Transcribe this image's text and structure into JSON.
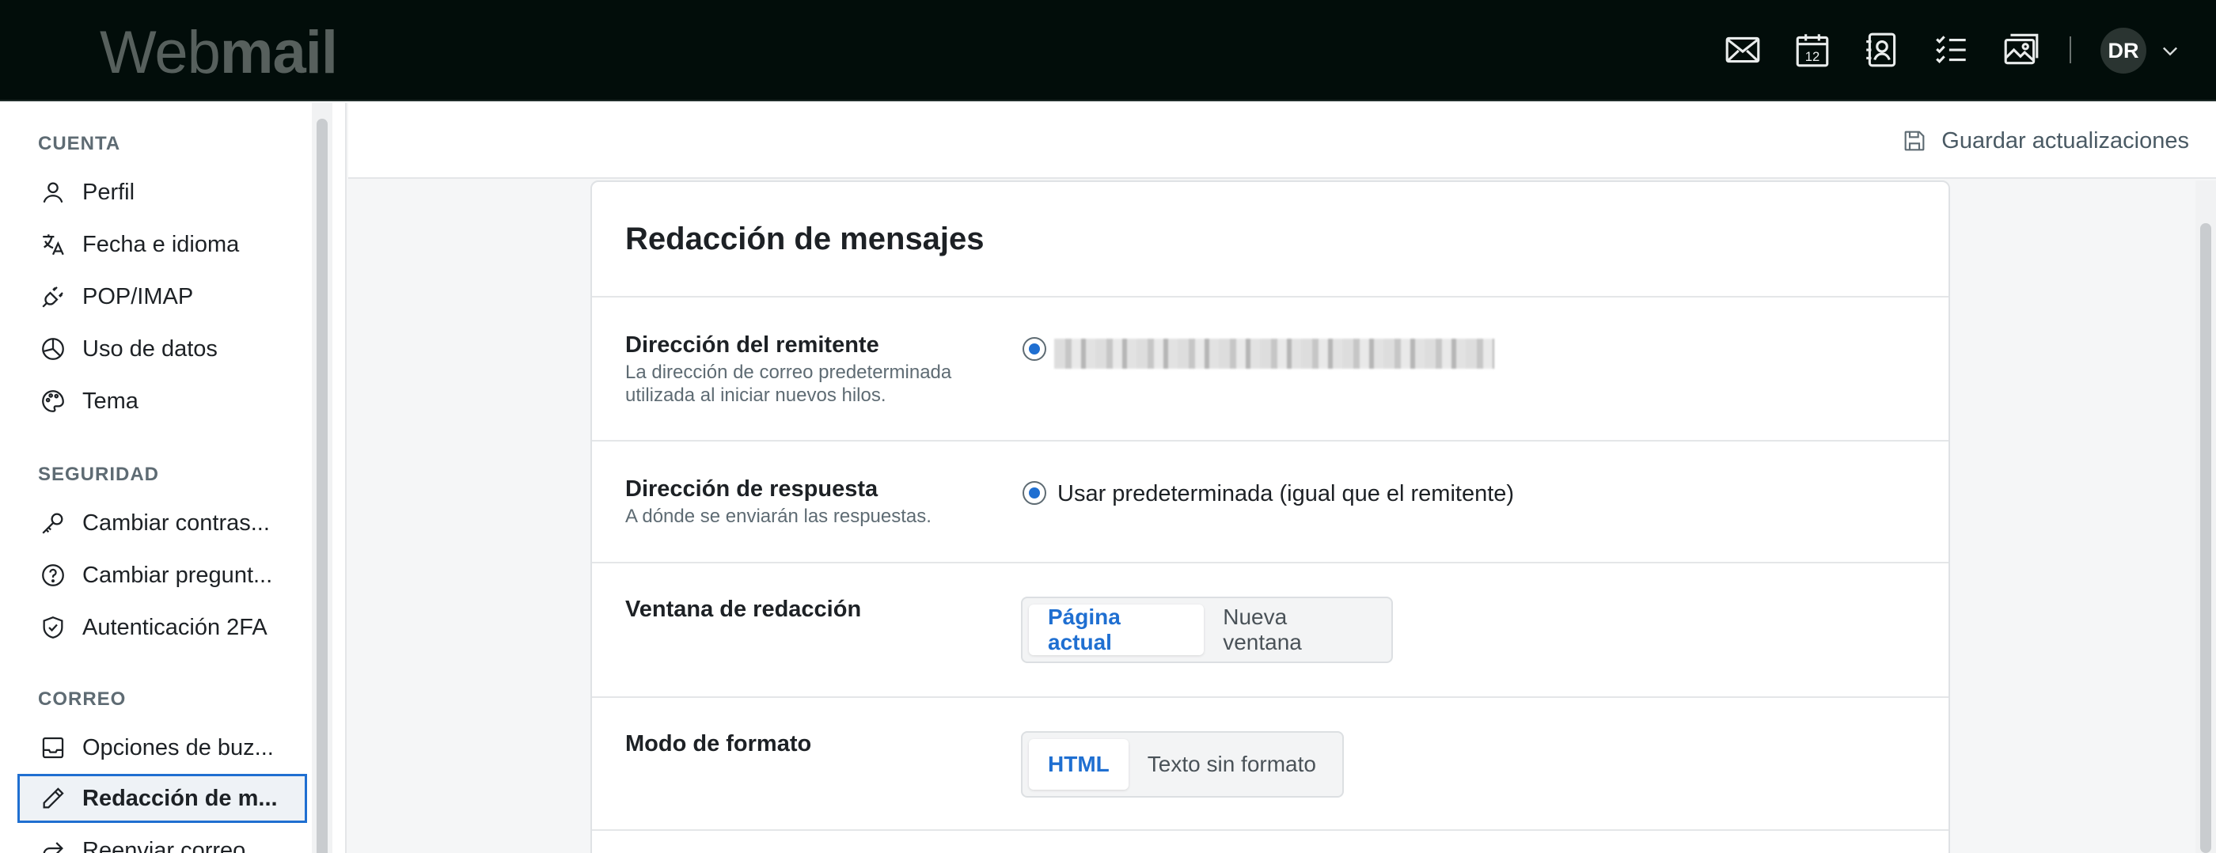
{
  "app": {
    "logo_light": "Web",
    "logo_bold": "mail",
    "user_initials": "DR",
    "accent_color": "#1f6fd1"
  },
  "topbar": {
    "icons": [
      "mail-icon",
      "calendar-icon",
      "contacts-icon",
      "tasks-icon",
      "photos-icon"
    ],
    "calendar_day": "12"
  },
  "sidebar": {
    "sections": [
      {
        "title": "CUENTA",
        "items": [
          {
            "label": "Perfil",
            "icon": "user-icon"
          },
          {
            "label": "Fecha e idioma",
            "icon": "translate-icon"
          },
          {
            "label": "POP/IMAP",
            "icon": "plug-icon"
          },
          {
            "label": "Uso de datos",
            "icon": "pie-chart-icon"
          },
          {
            "label": "Tema",
            "icon": "palette-icon"
          }
        ]
      },
      {
        "title": "SEGURIDAD",
        "items": [
          {
            "label": "Cambiar contras...",
            "icon": "key-icon"
          },
          {
            "label": "Cambiar pregunt...",
            "icon": "question-icon"
          },
          {
            "label": "Autenticación 2FA",
            "icon": "shield-check-icon"
          }
        ]
      },
      {
        "title": "CORREO",
        "items": [
          {
            "label": "Opciones de buz...",
            "icon": "inbox-icon"
          },
          {
            "label": "Redacción de m...",
            "icon": "pencil-icon",
            "active": true
          },
          {
            "label": "Reenviar correo...",
            "icon": "forward-icon"
          }
        ]
      }
    ]
  },
  "header": {
    "save_label": "Guardar actualizaciones"
  },
  "card": {
    "title": "Redacción de mensajes",
    "sender": {
      "label": "Dirección del remitente",
      "description": "La dirección de correo predeterminada utilizada al iniciar nuevos hilos."
    },
    "reply": {
      "label": "Dirección de respuesta",
      "description": "A dónde se enviarán las respuestas.",
      "option": "Usar predeterminada (igual que el remitente)"
    },
    "window": {
      "label": "Ventana de redacción",
      "options": [
        "Página actual",
        "Nueva ventana"
      ],
      "selected": "Página actual"
    },
    "format": {
      "label": "Modo de formato",
      "options": [
        "HTML",
        "Texto sin formato"
      ],
      "selected": "HTML"
    }
  }
}
